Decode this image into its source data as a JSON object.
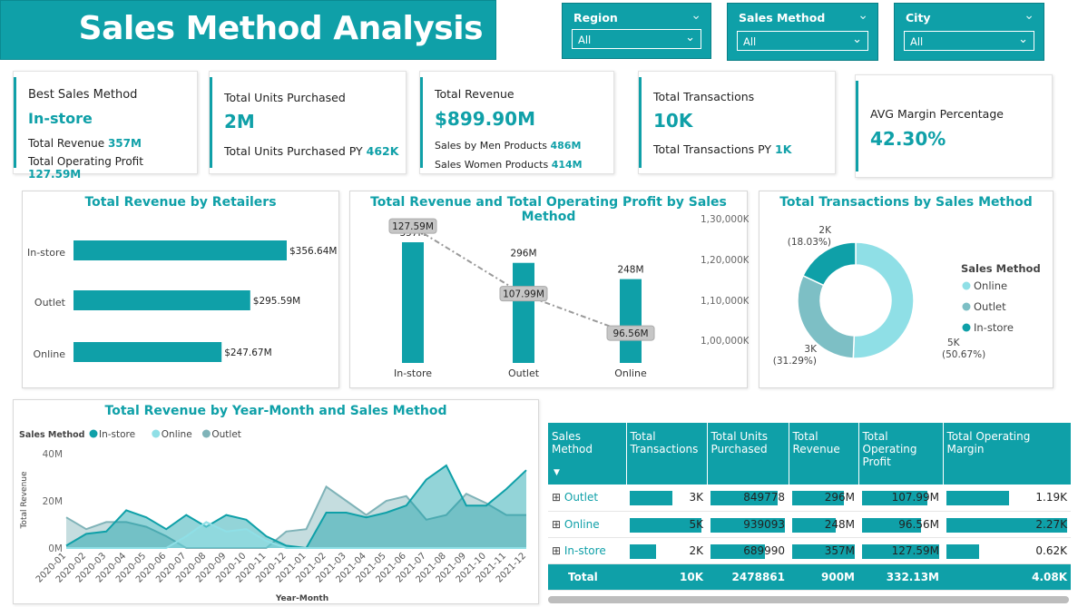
{
  "header": {
    "title": "Sales Method Analysis"
  },
  "slicers": [
    {
      "label": "Region",
      "value": "All"
    },
    {
      "label": "Sales Method",
      "value": "All"
    },
    {
      "label": "City",
      "value": "All"
    }
  ],
  "kpis": {
    "best": {
      "title": "Best Sales Method",
      "value": "In-store",
      "rev_label": "Total Revenue",
      "rev_value": "357M",
      "op_label": "Total Operating Profit",
      "op_value": "127.59M"
    },
    "units": {
      "title": "Total Units Purchased",
      "value": "2M",
      "py_label": "Total Units Purchased PY",
      "py_value": "462K"
    },
    "revenue": {
      "title": "Total Revenue",
      "value": "$899.90M",
      "men_label": "Sales by Men Products",
      "men_value": "486M",
      "women_label": "Sales Women Products",
      "women_value": "414M"
    },
    "transactions": {
      "title": "Total Transactions",
      "value": "10K",
      "py_label": "Total Transactions PY",
      "py_value": "1K"
    },
    "margin": {
      "title": "AVG Margin Percentage",
      "value": "42.30%"
    }
  },
  "retailers_chart": {
    "title": "Total Revenue by Retailers",
    "chart_data": {
      "type": "bar",
      "orientation": "horizontal",
      "categories": [
        "In-store",
        "Outlet",
        "Online"
      ],
      "values": [
        356.64,
        295.59,
        247.67
      ],
      "labels": [
        "$356.64M",
        "$295.59M",
        "$247.67M"
      ],
      "color": "#0fa0a8"
    }
  },
  "combo_chart": {
    "title": "Total Revenue and Total Operating Profit by Sales Method",
    "right_axis_ticks": [
      "1,30,000K",
      "1,20,000K",
      "1,10,000K",
      "1,00,000K"
    ],
    "chart_data": {
      "type": "bar",
      "categories": [
        "In-store",
        "Outlet",
        "Online"
      ],
      "series": [
        {
          "values": [
            357,
            296,
            248
          ],
          "labels": [
            "357M",
            "296M",
            "248M"
          ]
        },
        {
          "type": "line",
          "values": [
            127.59,
            107.99,
            96.56
          ],
          "labels": [
            "127.59M",
            "107.99M",
            "96.56M"
          ]
        }
      ]
    }
  },
  "donut_chart": {
    "title": "Total Transactions by Sales Method",
    "legend_title": "Sales Method",
    "chart_data": {
      "type": "pie",
      "categories": [
        "Online",
        "Outlet",
        "In-store"
      ],
      "values": [
        50.67,
        31.29,
        18.03
      ],
      "labels": [
        "5K",
        "3K",
        "2K"
      ],
      "percent_labels": [
        "(50.67%)",
        "(31.29%)",
        "(18.03%)"
      ],
      "colors": [
        "#8fdfe6",
        "#7dbfc5",
        "#0fa0a8"
      ]
    }
  },
  "area_chart": {
    "title": "Total Revenue by Year-Month and Sales Method",
    "legend_title": "Sales Method",
    "chart_data": {
      "type": "area",
      "x": [
        "2020-01",
        "2020-02",
        "2020-03",
        "2020-04",
        "2020-05",
        "2020-06",
        "2020-07",
        "2020-08",
        "2020-09",
        "2020-10",
        "2020-11",
        "2020-12",
        "2021-01",
        "2021-02",
        "2021-03",
        "2021-04",
        "2021-05",
        "2021-06",
        "2021-07",
        "2021-08",
        "2021-09",
        "2021-10",
        "2021-11",
        "2021-12"
      ],
      "xlabel": "Year-Month",
      "ylabel": "Total Revenue",
      "yticks": [
        "0M",
        "20M",
        "40M"
      ],
      "ylim": [
        0,
        40
      ],
      "series": [
        {
          "name": "In-store",
          "color": "#0fa0a8",
          "values": [
            1,
            6,
            7,
            16,
            13,
            8,
            14,
            9,
            14,
            12,
            5,
            1,
            0,
            15,
            15,
            13,
            15,
            18,
            29,
            35,
            18,
            18,
            25,
            33
          ]
        },
        {
          "name": "Online",
          "color": "#8fdfe6",
          "values": [
            0,
            0,
            0,
            0,
            0,
            0,
            5,
            11,
            7,
            8,
            3,
            0,
            0,
            0,
            0,
            0,
            0,
            0,
            0,
            0,
            0,
            0,
            0,
            0
          ]
        },
        {
          "name": "Outlet",
          "color": "#7fb3b8",
          "values": [
            13,
            8,
            11,
            11,
            9,
            5,
            0,
            0,
            0,
            0,
            0,
            7,
            8,
            26,
            20,
            14,
            20,
            22,
            12,
            14,
            23,
            19,
            14,
            14
          ]
        }
      ]
    }
  },
  "matrix": {
    "headers": [
      "Sales Method",
      "Total Transactions",
      "Total Units Purchased",
      "Total Revenue",
      "Total Operating Profit",
      "Total Operating Margin"
    ],
    "rows": [
      {
        "label": "Outlet",
        "transactions": "3K",
        "units": "849778",
        "revenue": "296M",
        "profit": "107.99M",
        "margin": "1.19K"
      },
      {
        "label": "Online",
        "transactions": "5K",
        "units": "939093",
        "revenue": "248M",
        "profit": "96.56M",
        "margin": "2.27K"
      },
      {
        "label": "In-store",
        "transactions": "2K",
        "units": "689990",
        "revenue": "357M",
        "profit": "127.59M",
        "margin": "0.62K"
      }
    ],
    "bar_fractions": [
      [
        0.58,
        0.9,
        0.83,
        0.85,
        0.52
      ],
      [
        0.97,
        1.0,
        0.69,
        0.76,
        1.0
      ],
      [
        0.36,
        0.73,
        1.0,
        1.0,
        0.27
      ]
    ],
    "total": {
      "label": "Total",
      "transactions": "10K",
      "units": "2478861",
      "revenue": "900M",
      "profit": "332.13M",
      "margin": "4.08K"
    }
  }
}
